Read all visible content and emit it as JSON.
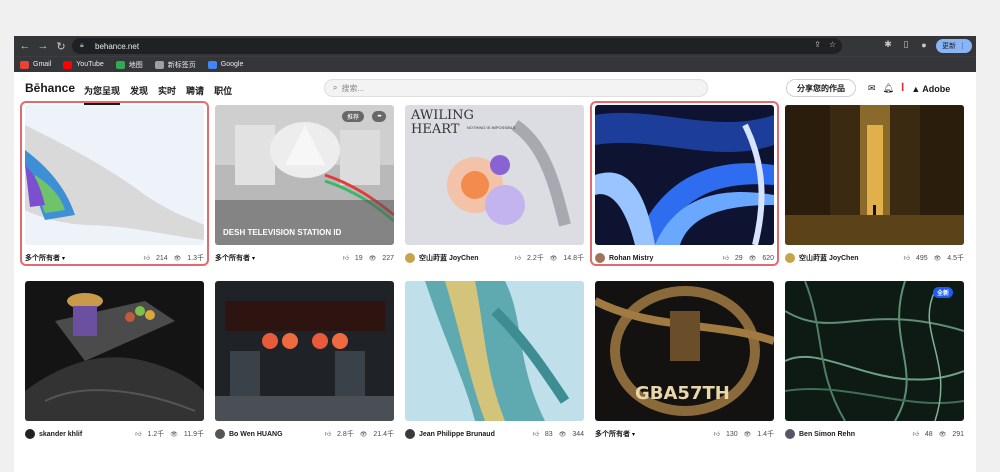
{
  "browser": {
    "url": "behance.net",
    "update_label": "更新",
    "bookmarks": [
      {
        "label": "Gmail",
        "color": "#ea4335"
      },
      {
        "label": "YouTube",
        "color": "#ff0000"
      },
      {
        "label": "地图",
        "color": "#34a853"
      },
      {
        "label": "新标签页",
        "color": "#9aa0a6"
      },
      {
        "label": "Google",
        "color": "#4285f4"
      }
    ]
  },
  "header": {
    "logo": "Bēhance",
    "nav": [
      "为您呈现",
      "发现",
      "实时",
      "聘请",
      "职位"
    ],
    "search_placeholder": "搜索...",
    "share_label": "分享您的作品",
    "adobe_label": "Adobe"
  },
  "cards": [
    {
      "owner": "多个所有者",
      "likes": "214",
      "views": "1.3千",
      "multi": true,
      "highlight": true,
      "title": "",
      "recommend": "",
      "badge": ""
    },
    {
      "owner": "多个所有者",
      "likes": "19",
      "views": "227",
      "multi": true,
      "highlight": false,
      "title": "DESH TELEVISION STATION ID",
      "recommend": "推荐",
      "badge": ""
    },
    {
      "owner": "空山莳蓝 JoyChen",
      "likes": "2.2千",
      "views": "14.8千",
      "multi": false,
      "highlight": false,
      "title": "",
      "recommend": "",
      "badge": ""
    },
    {
      "owner": "Rohan Mistry",
      "likes": "29",
      "views": "620",
      "multi": false,
      "highlight": true,
      "title": "",
      "recommend": "",
      "badge": ""
    },
    {
      "owner": "空山莳蓝 JoyChen",
      "likes": "495",
      "views": "4.5千",
      "multi": false,
      "highlight": false,
      "title": "",
      "recommend": "",
      "badge": ""
    },
    {
      "owner": "skander khlif",
      "likes": "1.2千",
      "views": "11.9千",
      "multi": false,
      "highlight": false,
      "title": "",
      "recommend": "",
      "badge": ""
    },
    {
      "owner": "Bo Wen HUANG",
      "likes": "2.8千",
      "views": "21.4千",
      "multi": false,
      "highlight": false,
      "title": "",
      "recommend": "",
      "badge": ""
    },
    {
      "owner": "Jean Philippe Brunaud",
      "likes": "83",
      "views": "344",
      "multi": false,
      "highlight": false,
      "title": "",
      "recommend": "",
      "badge": ""
    },
    {
      "owner": "多个所有者",
      "likes": "130",
      "views": "1.4千",
      "multi": true,
      "highlight": false,
      "title": "",
      "recommend": "",
      "badge": ""
    },
    {
      "owner": "Ben Simon Rehn",
      "likes": "48",
      "views": "291",
      "multi": false,
      "highlight": false,
      "title": "",
      "recommend": "",
      "badge": "全新"
    }
  ],
  "thumb_text": {
    "c3_l1": "AWILING",
    "c3_l2": "HEART",
    "c3_l3": "NOTHING IS IMPOSSIBLE",
    "c9_big": "GBA57TH"
  }
}
